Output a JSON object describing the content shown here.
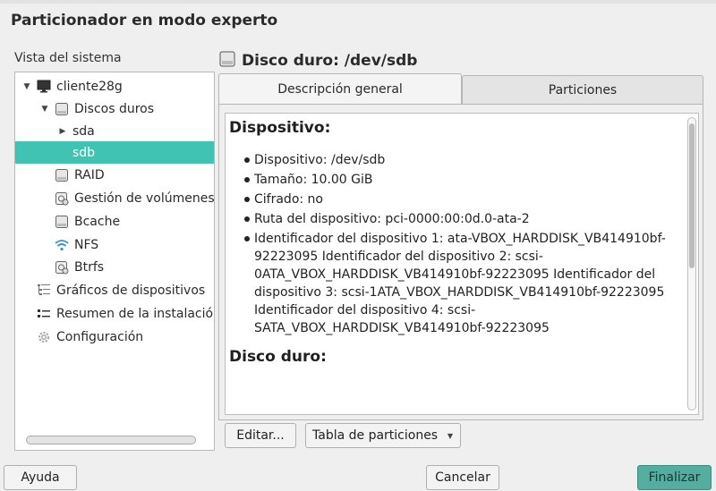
{
  "page": {
    "title": "Particionador en modo experto",
    "system_view_label": "Vista del sistema"
  },
  "tree": {
    "items": [
      {
        "label": "cliente28g",
        "icon": "monitor-icon",
        "arrow": "▼"
      },
      {
        "label": "Discos duros",
        "icon": "hard-disk-icon",
        "arrow": "▼"
      },
      {
        "label": "sda",
        "icon": "",
        "arrow": "▶"
      },
      {
        "label": "sdb",
        "icon": "",
        "arrow": ""
      },
      {
        "label": "RAID",
        "icon": "hard-disk-icon",
        "arrow": ""
      },
      {
        "label": "Gestión de volúmenes",
        "icon": "volume-manager-icon",
        "arrow": ""
      },
      {
        "label": "Bcache",
        "icon": "hard-disk-icon",
        "arrow": ""
      },
      {
        "label": "NFS",
        "icon": "wifi-icon",
        "arrow": ""
      },
      {
        "label": "Btrfs",
        "icon": "volume-manager-icon",
        "arrow": ""
      },
      {
        "label": "Gráficos de dispositivos",
        "icon": "device-graph-icon",
        "arrow": ""
      },
      {
        "label": "Resumen de la instalación",
        "icon": "list-icon",
        "arrow": ""
      },
      {
        "label": "Configuración",
        "icon": "gear-icon",
        "arrow": ""
      }
    ],
    "selected": "sdb"
  },
  "disk": {
    "header": "Disco duro: /dev/sdb"
  },
  "tabs": {
    "overview": "Descripción general",
    "partitions": "Particiones"
  },
  "overview": {
    "section_device": "Dispositivo:",
    "bullets": [
      "Dispositivo: /dev/sdb",
      "Tamaño: 10.00 GiB",
      "Cifrado: no",
      "Ruta del dispositivo: pci-0000:00:0d.0-ata-2",
      "Identificador del dispositivo 1: ata-VBOX_HARDDISK_VB414910bf-92223095 Identificador del dispositivo 2: scsi-0ATA_VBOX_HARDDISK_VB414910bf-92223095 Identificador del dispositivo 3: scsi-1ATA_VBOX_HARDDISK_VB414910bf-92223095 Identificador del dispositivo 4: scsi-SATA_VBOX_HARDDISK_VB414910bf-92223095"
    ],
    "section_disk": "Disco duro:"
  },
  "actions": {
    "edit": "Editar...",
    "partition_table": "Tabla de particiones"
  },
  "footer": {
    "help": "Ayuda",
    "cancel": "Cancelar",
    "finish": "Finalizar"
  },
  "colors": {
    "selection": "#41c3b4",
    "primary_button": "#55ad9f"
  }
}
